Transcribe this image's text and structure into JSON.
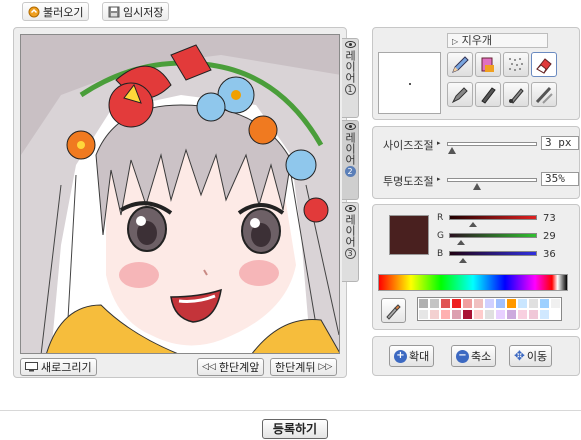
{
  "top_buttons": {
    "load_label": "불러오기",
    "temp_save_label": "임시저장"
  },
  "layers": [
    {
      "label": "레이어",
      "num": "1",
      "active": false
    },
    {
      "label": "레이어",
      "num": "2",
      "active": true
    },
    {
      "label": "레이어",
      "num": "3",
      "active": false
    }
  ],
  "canvas_buttons": {
    "new_drawing_label": "새로그리기",
    "undo_label": "한단계앞",
    "redo_label": "한단계뒤"
  },
  "tools": {
    "current_tool": "지우개",
    "items": [
      "pencil-icon",
      "brush-icon",
      "spray-icon",
      "eraser-icon",
      "marker-icon",
      "pen-icon",
      "fill-icon",
      "smudge-icon"
    ]
  },
  "sliders": {
    "size_label": "사이즈조절",
    "size_value": "3 px",
    "size_level": 0.02,
    "opacity_label": "투명도조절",
    "opacity_value": "35%",
    "opacity_level": 0.35
  },
  "color": {
    "current_hex": "#49201f",
    "r_label": "R",
    "r_value": "73",
    "g_label": "G",
    "g_value": "29",
    "b_label": "B",
    "b_value": "36",
    "palette": [
      "#b0b0b0",
      "#c4c4c4",
      "#e05555",
      "#ee2222",
      "#f0a0a0",
      "#f0c0c0",
      "#d0d0ff",
      "#a0c0ff",
      "#ff9900",
      "#c9e6ff",
      "#e0e0e0",
      "#9ed0ff",
      "#f0f0f0",
      "#e6e6e6",
      "#f3d0d0",
      "#ffb0b0",
      "#dca0b0",
      "#aa1133",
      "#ffcccc",
      "#e0e0e0",
      "#e8d0ff",
      "#ccaadd",
      "#f8d0e0",
      "#f0c8d8",
      "#d0e8ff",
      "#ffffff"
    ]
  },
  "view_buttons": {
    "zoom_in_label": "확대",
    "zoom_out_label": "축소",
    "move_label": "이동"
  },
  "submit_label": "등록하기"
}
